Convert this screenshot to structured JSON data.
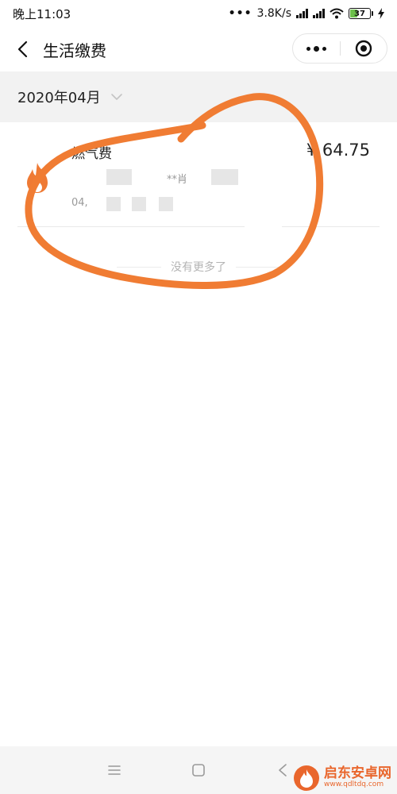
{
  "status_bar": {
    "time": "晚上11:03",
    "network_speed": "3.8K/s",
    "battery_level": "37",
    "battery_percent": 37
  },
  "nav": {
    "title": "生活缴费"
  },
  "filter": {
    "month": "2020年04月"
  },
  "bill": {
    "title": "燃气费",
    "amount": "¥ 64.75",
    "line2_visible": "**肖",
    "line3_visible": "04,"
  },
  "list_footer": {
    "no_more": "没有更多了"
  },
  "annotation": {
    "color": "#f07c33"
  },
  "colors": {
    "flame": "#ef7a34",
    "watermark": "#e9662c"
  },
  "watermark": {
    "name": "启东安卓网",
    "url": "www.qdltdq.com"
  },
  "icons": {
    "back": "chevron-left-icon",
    "more": "more-dots-icon",
    "close": "target-close-icon",
    "month_dropdown": "chevron-down-icon",
    "bill": "flame-icon",
    "sys_menu": "menu-lines-icon",
    "sys_home": "square-home-icon",
    "sys_back": "triangle-back-icon"
  }
}
